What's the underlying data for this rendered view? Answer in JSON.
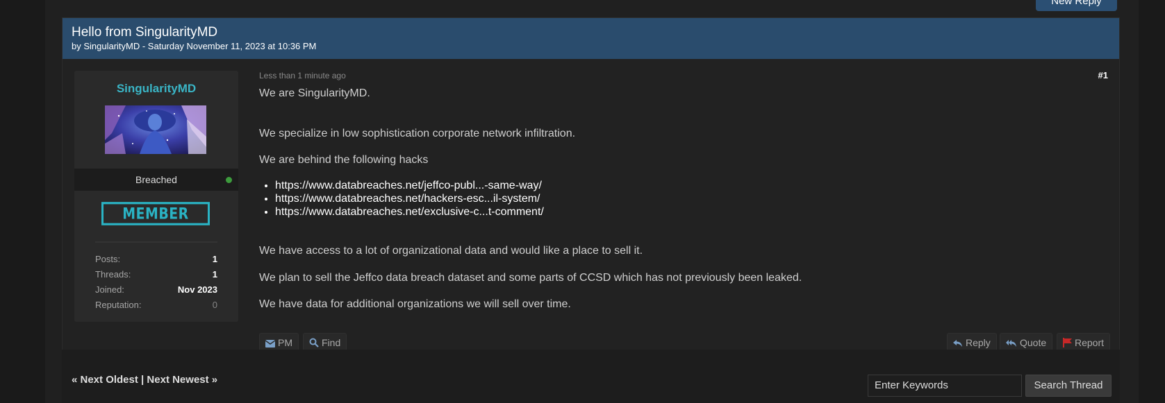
{
  "header": {
    "new_reply_label": "New Reply"
  },
  "post": {
    "title": "Hello from SingularityMD",
    "meta": "by SingularityMD - Saturday November 11, 2023 at 10:36 PM",
    "time_ago": "Less than 1 minute ago",
    "post_number": "#1",
    "body": {
      "line1": "We are SingularityMD.",
      "line2": "We specialize in low sophistication corporate network infiltration.",
      "line3": "We are behind the following hacks",
      "links": [
        "https://www.databreaches.net/jeffco-publ...-same-way/",
        "https://www.databreaches.net/hackers-esc...il-system/",
        "https://www.databreaches.net/exclusive-c...t-comment/"
      ],
      "line4": "We have access to a lot of organizational data and would like a place to sell it.",
      "line5": "We plan to sell the Jeffco data breach dataset and some parts of CCSD which has not previously been leaked.",
      "line6": "We have data for additional organizations we will sell over time."
    },
    "buttons": {
      "pm": "PM",
      "find": "Find",
      "reply": "Reply",
      "quote": "Quote",
      "report": "Report"
    }
  },
  "user": {
    "username": "SingularityMD",
    "group": "Breached",
    "badge": "MEMBER",
    "stats": [
      {
        "label": "Posts:",
        "value": "1"
      },
      {
        "label": "Threads:",
        "value": "1"
      },
      {
        "label": "Joined:",
        "value": "Nov 2023"
      },
      {
        "label": "Reputation:",
        "value": "0"
      }
    ]
  },
  "footer": {
    "next_oldest": "« Next Oldest",
    "separator": " | ",
    "next_newest": "Next Newest »",
    "search_value": "Enter Keywords",
    "search_button": "Search Thread"
  },
  "colors": {
    "header_bg": "#2a4c6d",
    "username": "#3ab5c6",
    "badge": "#2ab3c4",
    "online": "#3d9b3d",
    "report_flag": "#c62828",
    "icon_blue": "#7aa0c8"
  }
}
